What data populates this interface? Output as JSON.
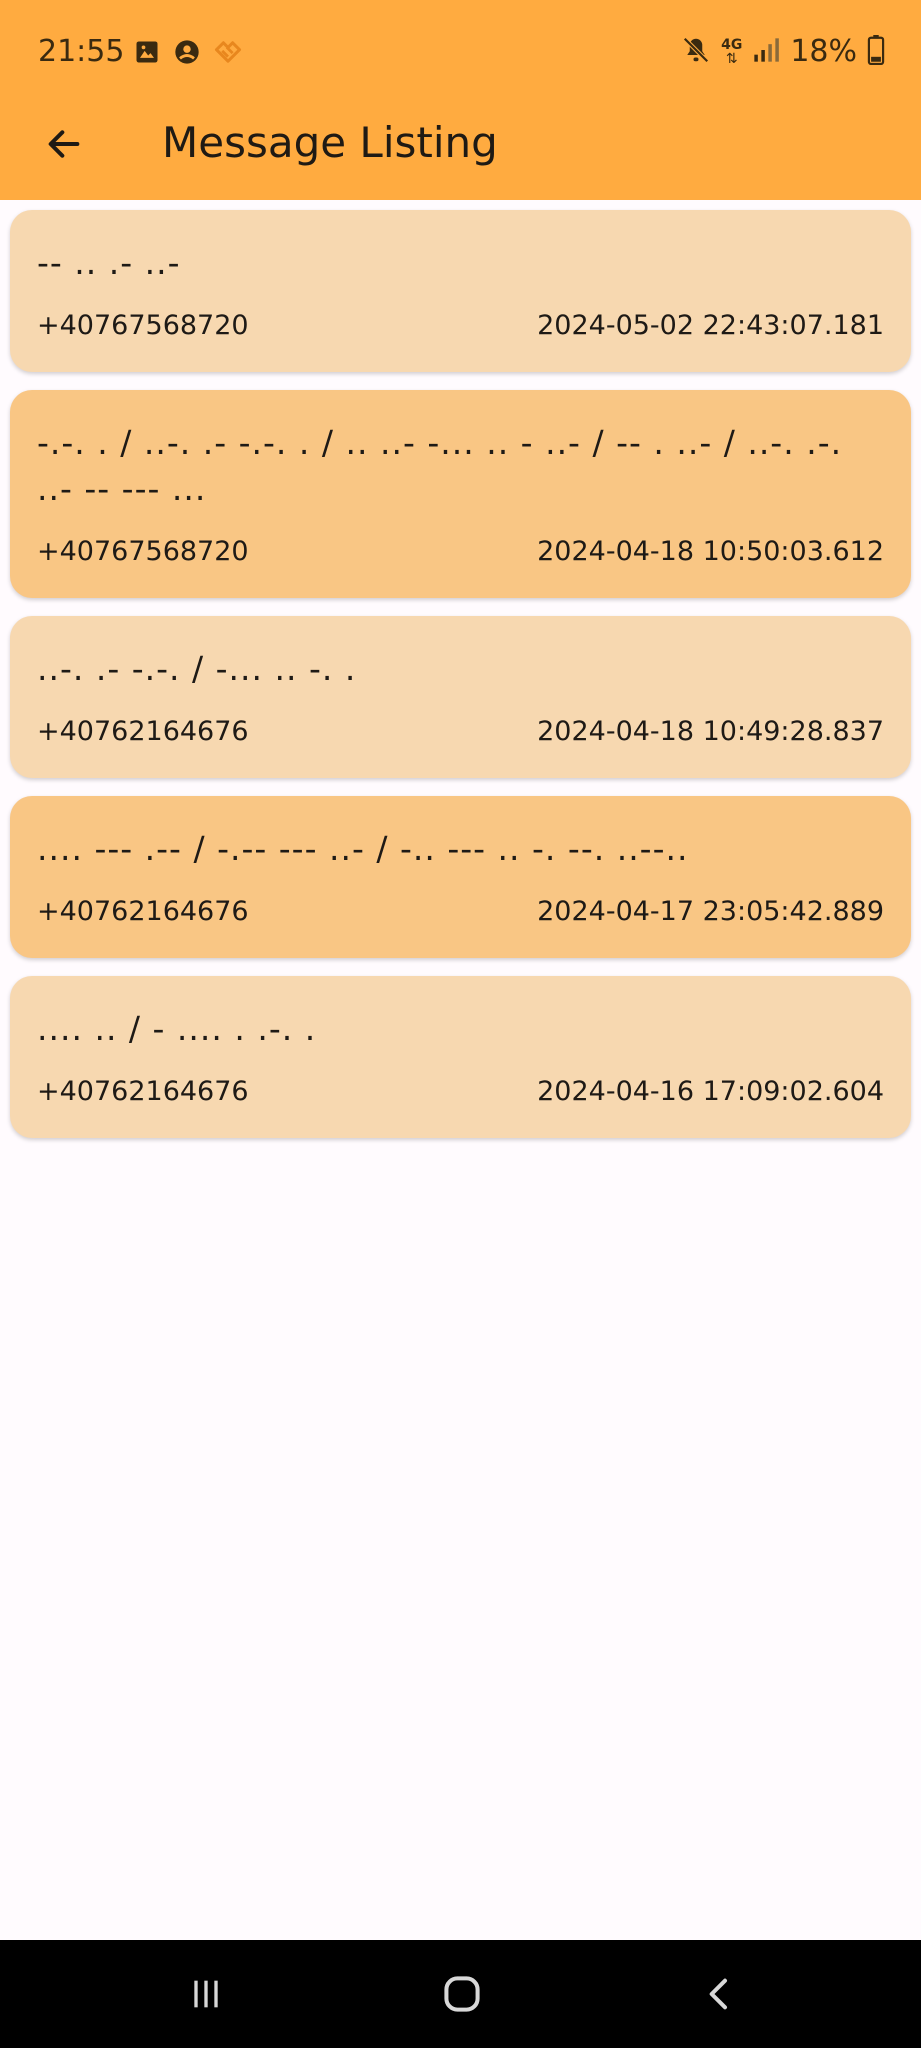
{
  "status_bar": {
    "time": "21:55",
    "battery": "18%",
    "network": "4G",
    "icons": [
      "image-icon",
      "account-icon",
      "app-notification-icon",
      "mute-icon",
      "signal-icon",
      "battery-icon"
    ]
  },
  "app_bar": {
    "title": "Message Listing",
    "back_icon": "arrow-back-icon"
  },
  "colors": {
    "app_bar": "#ffab40",
    "card_light": "#f7d8b0",
    "card_dark": "#f9c684",
    "background": "#fffbfe",
    "nav_bar": "#000000"
  },
  "messages": [
    {
      "text": "-- .. .- ..-",
      "phone": "+40767568720",
      "timestamp": "2024-05-02 22:43:07.181"
    },
    {
      "text": "-.-. . / ..-. .- -.-. . / .. ..- -... .. - ..- / -- . ..- / ..-. .-. ..- -- --- ...",
      "phone": "+40767568720",
      "timestamp": "2024-04-18 10:50:03.612"
    },
    {
      "text": "..-. .- -.-. / -... .. -. .",
      "phone": "+40762164676",
      "timestamp": "2024-04-18 10:49:28.837"
    },
    {
      "text": ".... --- .-- / -.-- --- ..- / -.. --- .. -. --. ..--..",
      "phone": "+40762164676",
      "timestamp": "2024-04-17 23:05:42.889"
    },
    {
      "text": ".... .. / - .... . .-. .",
      "phone": "+40762164676",
      "timestamp": "2024-04-16 17:09:02.604"
    }
  ],
  "nav_bar": {
    "icons": [
      "recent-apps-icon",
      "home-icon",
      "back-icon"
    ]
  }
}
